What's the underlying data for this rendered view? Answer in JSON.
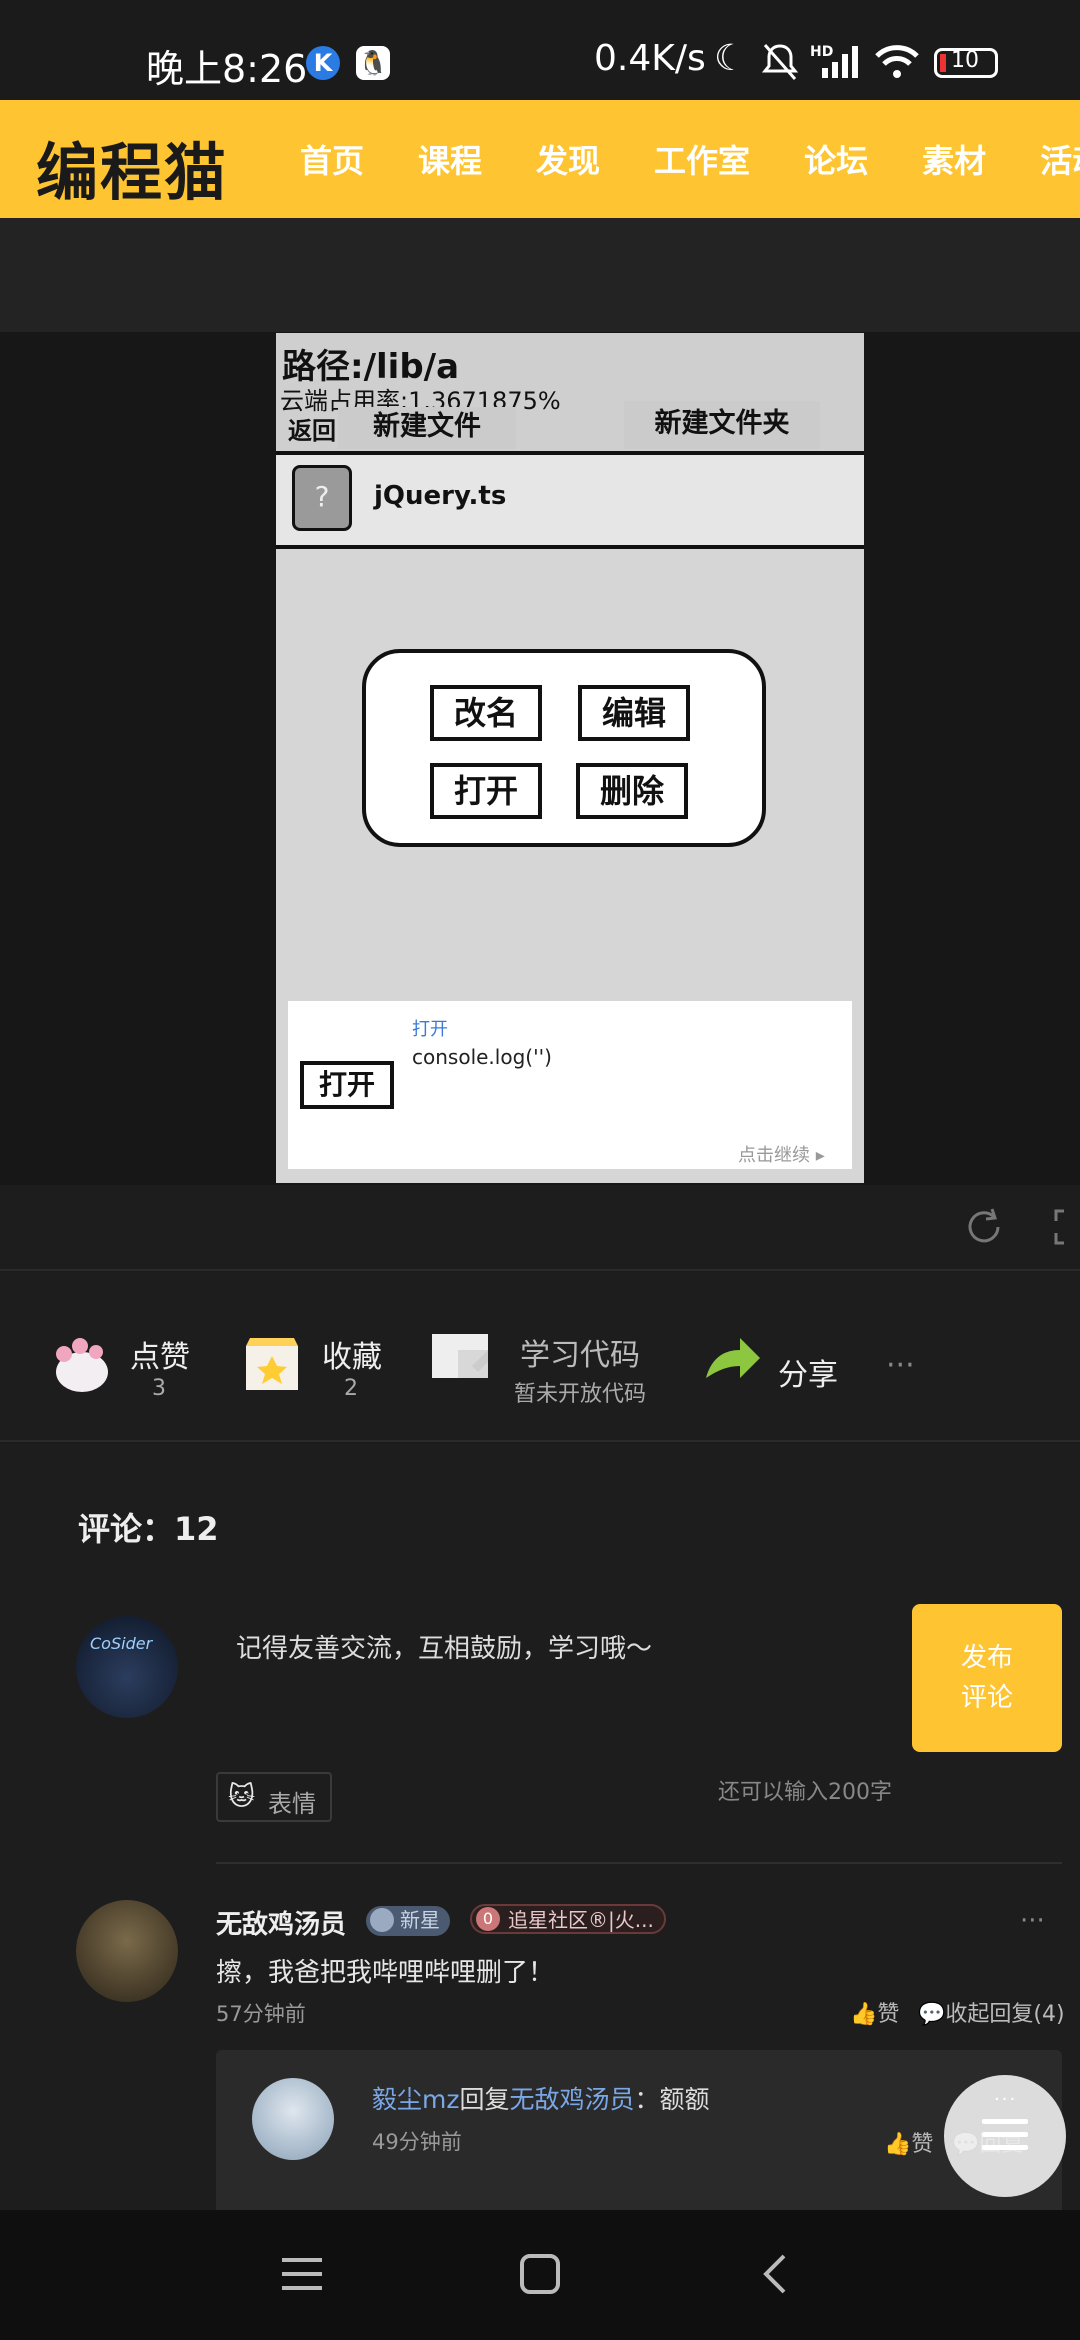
{
  "status_bar": {
    "time": "晚上8:26",
    "network_speed": "0.4K/s",
    "signal_label": "HD",
    "battery": "10"
  },
  "header": {
    "logo": "编程猫",
    "nav": [
      "首页",
      "课程",
      "发现",
      "工作室",
      "论坛",
      "素材",
      "活动"
    ]
  },
  "stage": {
    "path_label": "路径:/lib/a",
    "usage_label": "云端占用率:1.3671875%",
    "back_button": "返回",
    "new_file_button": "新建文件",
    "new_folder_button": "新建文件夹",
    "file_icon": "?",
    "file_name": "jQuery.ts",
    "dialog": {
      "rename": "改名",
      "edit": "编辑",
      "open": "打开",
      "delete": "删除"
    },
    "panel": {
      "button": "打开",
      "title": "打开",
      "code": "console.log('')",
      "continue_hint": "点击继续"
    }
  },
  "actions": {
    "like": {
      "label": "点赞",
      "count": "3"
    },
    "favorite": {
      "label": "收藏",
      "count": "2"
    },
    "learn": {
      "label": "学习代码",
      "sub": "暂未开放代码"
    },
    "share": {
      "label": "分享"
    },
    "more": "···"
  },
  "comments": {
    "title": "评论：12",
    "input_placeholder": "记得友善交流，互相鼓励，学习哦～",
    "publish_button_line1": "发布",
    "publish_button_line2": "评论",
    "emoji_button": "表情",
    "char_remaining": "还可以输入200字",
    "items": [
      {
        "author": "无敌鸡汤员",
        "badge1": "新星",
        "badge2": "追星社区®|火...",
        "badge2_num": "0",
        "text": "擦，我爸把我哔哩哔哩删了！",
        "time": "57分钟前",
        "like_label": "赞",
        "reply_toggle": "收起回复(4)",
        "replies": [
          {
            "author": "毅尘mz",
            "reply_word": "回复",
            "target": "无敌鸡汤员",
            "text": "：额额",
            "time": "49分钟前",
            "like_label": "赞",
            "reply_label": "回复"
          }
        ]
      }
    ]
  },
  "colors": {
    "brand_yellow": "#fec432",
    "background": "#1d1d1e",
    "link_blue": "#7aa8e6"
  }
}
